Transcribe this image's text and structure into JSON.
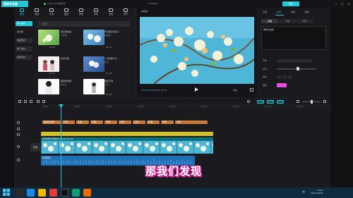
{
  "app": {
    "logo_text": "剪映专业版",
    "title_left": "12月14日剪映草稿",
    "title_center": "4294461",
    "export_label": "导出",
    "window_buttons": [
      "—",
      "□",
      "✕"
    ]
  },
  "media_tools": [
    {
      "label": "媒体",
      "icon": "media-icon",
      "active": true
    },
    {
      "label": "音频",
      "icon": "audio-icon",
      "active": false
    },
    {
      "label": "文本",
      "icon": "text-icon",
      "active": false
    },
    {
      "label": "贴纸",
      "icon": "sticker-icon",
      "active": false
    },
    {
      "label": "特效",
      "icon": "effects-icon",
      "active": false
    },
    {
      "label": "转场",
      "icon": "transition-icon",
      "active": false
    },
    {
      "label": "滤镜",
      "icon": "filter-icon",
      "active": false
    },
    {
      "label": "调节",
      "icon": "adjust-icon",
      "active": false
    }
  ],
  "categories": [
    "导入素材",
    "素材库",
    "收藏素材",
    "热门素材",
    "搞笑素材"
  ],
  "media_search_placeholder": "搜索",
  "media_items": [
    {
      "title": "春天的故事",
      "author": "刀郎版",
      "duration": "03:21"
    },
    {
      "title": "开满鲜花的房子",
      "author": "林峰版",
      "duration": "05:22"
    },
    {
      "title": "春风又绿",
      "author": "",
      "duration": "04:11"
    },
    {
      "title": "一朵花那么大",
      "author": "花朵",
      "duration": "03:48"
    },
    {
      "title": "美丽的玫瑰",
      "author": "花仙子",
      "duration": "03:12"
    },
    {
      "title": "鲜花开满",
      "author": "刀郎",
      "duration": "04:05"
    }
  ],
  "player": {
    "title": "播放器",
    "time_current": "00:00:00:00",
    "time_total": "00:05:01:10",
    "ratio_label": "原始"
  },
  "props": {
    "tabs": [
      "字幕",
      "文本",
      "动画",
      "朗读"
    ],
    "active_tab": "文本",
    "subtabs": [
      "基础",
      "气泡",
      "花字"
    ],
    "text_value": "那我们发现",
    "rows": [
      {
        "label": "字体"
      },
      {
        "label": "字号"
      },
      {
        "label": "样式"
      },
      {
        "label": "颜色"
      }
    ],
    "color_hex": "#e84de0"
  },
  "timeline": {
    "ticks": [
      "00:00",
      "00:10",
      "00:20",
      "00:30",
      "00:40",
      "00:50",
      "01:00",
      "01:10",
      "01:20"
    ],
    "cover_label": "封面",
    "main_clip_label": "春天鲜花开满枝头 00:05:01:10",
    "audio_label": "背景音乐",
    "orange_clips": [
      "那我们发现",
      "字幕",
      "字幕",
      "字幕",
      "字幕",
      "字幕",
      "字幕",
      "字幕",
      "字幕",
      "字幕"
    ]
  },
  "subtitle_overlay": "那我们发现",
  "taskbar": {
    "lang": "中",
    "time": "13:13",
    "date": "2022-06-24"
  }
}
